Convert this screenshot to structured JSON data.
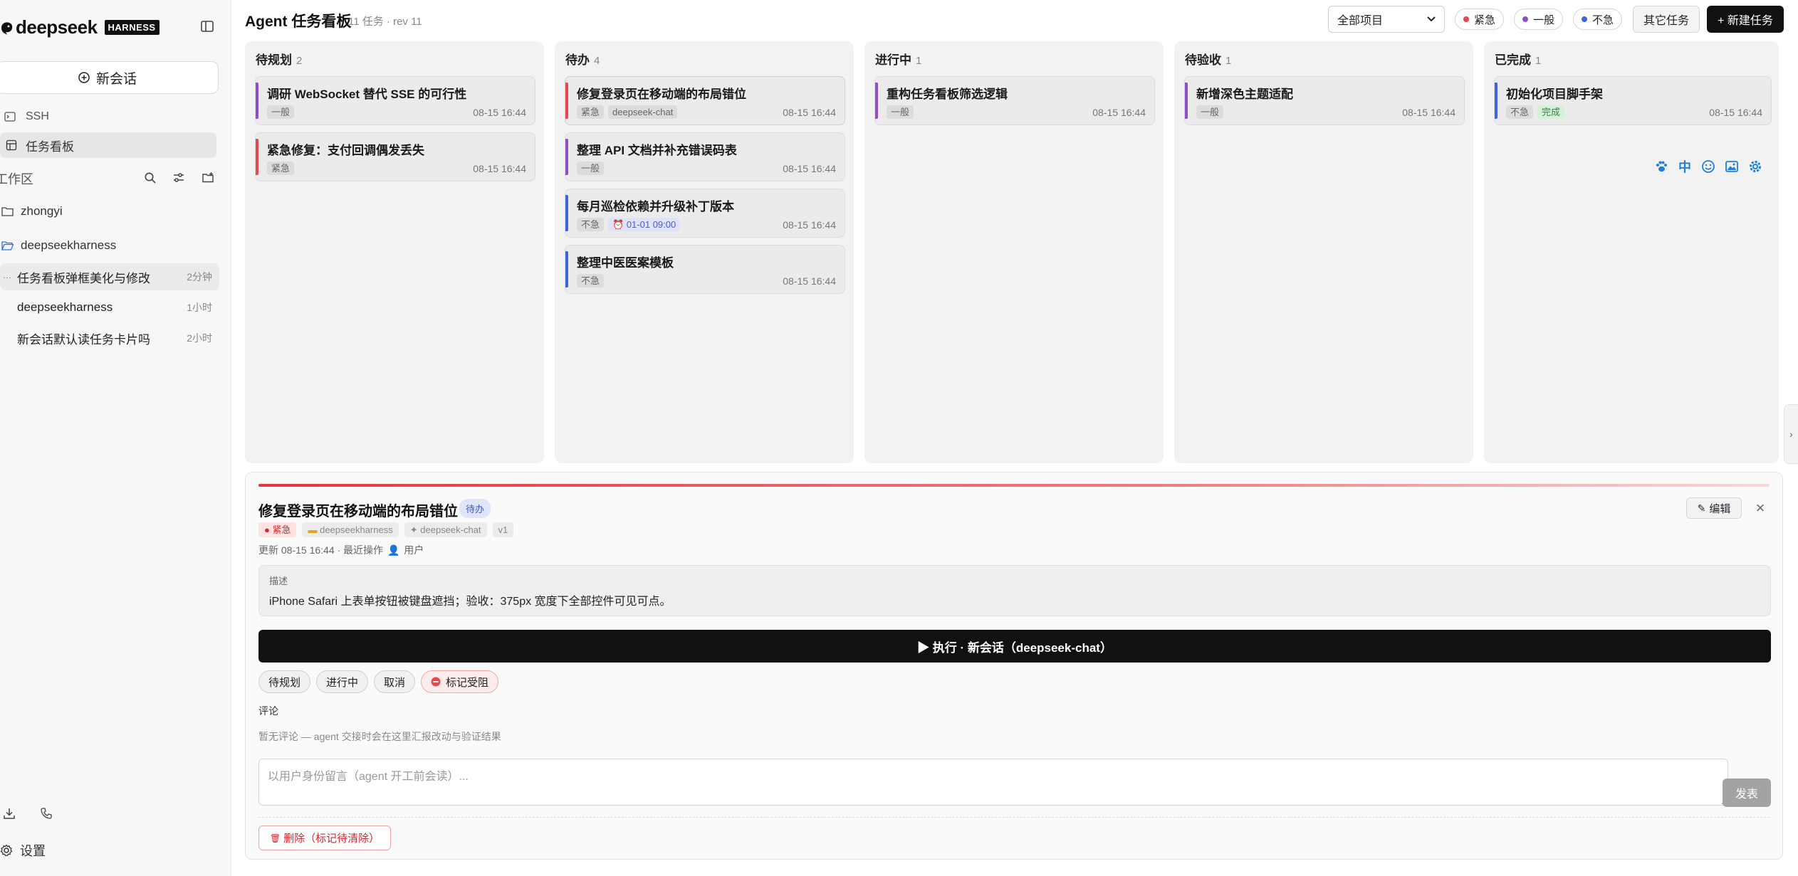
{
  "sidebar": {
    "brand": "deepseek",
    "badge": "HARNESS",
    "new_chat": "新会话",
    "ssh": "SSH",
    "kanban": "任务看板",
    "workspace_label": "工作区",
    "folders": [
      "zhongyi",
      "deepseekharness"
    ],
    "sessions": [
      {
        "title": "任务看板弹框美化与修改",
        "time": "2分钟"
      },
      {
        "title": "deepseekharness",
        "time": "1小时"
      },
      {
        "title": "新会话默认读任务卡片吗",
        "time": "2小时"
      }
    ],
    "settings": "设置"
  },
  "topbar": {
    "title": "Agent 任务看板",
    "meta": "11 任务 · rev 11",
    "project_select": "全部项目",
    "priorities": [
      {
        "label": "紧急",
        "color": "#e5484d"
      },
      {
        "label": "一般",
        "color": "#8e4ec6"
      },
      {
        "label": "不急",
        "color": "#3e63dd"
      }
    ],
    "other_tasks": "其它任务",
    "new_task": "+ 新建任务"
  },
  "columns": [
    {
      "name": "待规划",
      "count": "2",
      "cards": [
        {
          "title": "调研 WebSocket 替代 SSE 的可行性",
          "tags": [
            "一般"
          ],
          "date": "08-15 16:44",
          "color": "#8e4ec6"
        },
        {
          "title": "紧急修复：支付回调偶发丢失",
          "tags": [
            "紧急"
          ],
          "date": "08-15 16:44",
          "color": "#e5484d"
        }
      ]
    },
    {
      "name": "待办",
      "count": "4",
      "cards": [
        {
          "title": "修复登录页在移动端的布局错位",
          "tags": [
            "紧急",
            "deepseek-chat"
          ],
          "date": "08-15 16:44",
          "color": "#e5484d"
        },
        {
          "title": "整理 API 文档并补充错误码表",
          "tags": [
            "一般"
          ],
          "date": "08-15 16:44",
          "color": "#8e4ec6"
        },
        {
          "title": "每月巡检依赖并升级补丁版本",
          "tags": [
            "不急"
          ],
          "due": "01-01 09:00",
          "date": "08-15 16:44",
          "color": "#3e63dd"
        },
        {
          "title": "整理中医医案模板",
          "tags": [
            "不急"
          ],
          "date": "08-15 16:44",
          "color": "#3e63dd"
        }
      ]
    },
    {
      "name": "进行中",
      "count": "1",
      "cards": [
        {
          "title": "重构任务看板筛选逻辑",
          "tags": [
            "一般"
          ],
          "date": "08-15 16:44",
          "color": "#8e4ec6"
        }
      ]
    },
    {
      "name": "待验收",
      "count": "1",
      "cards": [
        {
          "title": "新增深色主题适配",
          "tags": [
            "一般"
          ],
          "date": "08-15 16:44",
          "color": "#8e4ec6"
        }
      ]
    },
    {
      "name": "已完成",
      "count": "1",
      "cards": [
        {
          "title": "初始化项目脚手架",
          "tags": [
            "不急"
          ],
          "done": "完成",
          "date": "08-15 16:44",
          "color": "#3e63dd"
        }
      ]
    }
  ],
  "float_icons": {
    "lang": "中"
  },
  "detail": {
    "title": "修复登录页在移动端的布局错位",
    "status": "待办",
    "tags": [
      "● 紧急",
      "deepseekharness",
      "deepseek-chat",
      "v1"
    ],
    "meta_prefix": "更新 08-15 16:44 · 最近操作",
    "meta_user": "用户",
    "desc_label": "描述",
    "desc_text": "iPhone Safari 上表单按钮被键盘遮挡；验收：375px 宽度下全部控件可见可点。",
    "run_label": "▶ 执行 · 新会话（deepseek-chat）",
    "actions": [
      "待规划",
      "进行中",
      "取消"
    ],
    "block_label": "标记受阻",
    "comment_label": "评论",
    "comment_empty": "暂无评论 — agent 交接时会在这里汇报改动与验证结果",
    "comment_placeholder": "以用户身份留言（agent 开工前会读）...",
    "post_label": "发表",
    "edit_label": "编辑",
    "delete_label": "删除（标记待清除）"
  }
}
